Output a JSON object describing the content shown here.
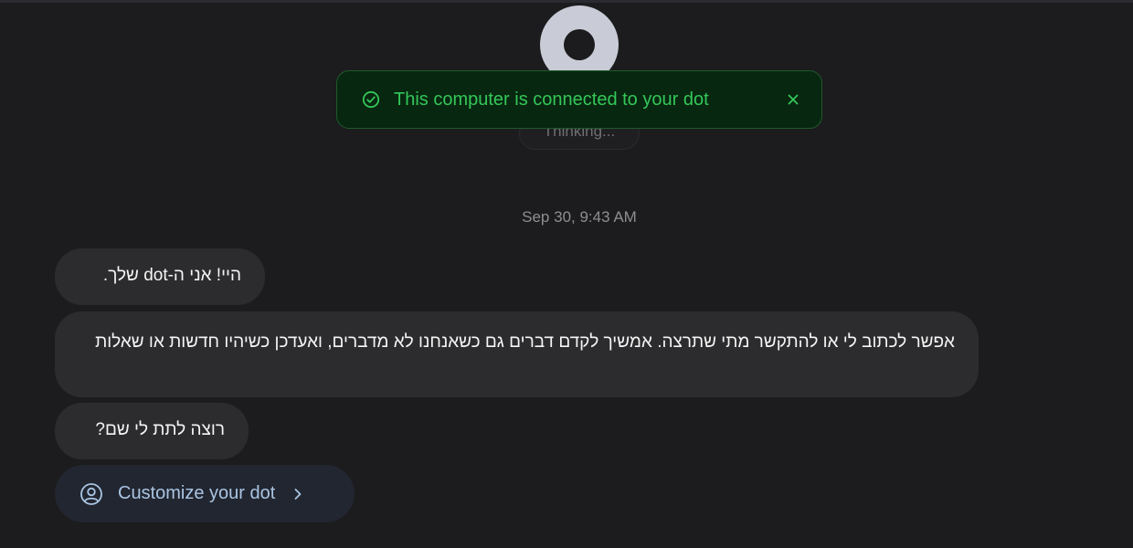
{
  "header": {
    "avatar_icon": "dot-avatar-icon",
    "thinking_label": "Thinking..."
  },
  "toast": {
    "message": "This computer is connected to your dot",
    "status_icon": "check-circle-icon",
    "close_icon": "close-icon",
    "accent_color": "#34c759"
  },
  "chat": {
    "timestamp": "Sep 30, 9:43 AM",
    "messages": [
      {
        "text": "היי! אני ה-dot שלך."
      },
      {
        "text": "אפשר לכתוב לי או להתקשר מתי שתרצה. אמשיך לקדם דברים גם כשאנחנו לא מדברים, ואעדכן כשיהיו חדשות או שאלות"
      },
      {
        "text": "רוצה לתת לי שם?"
      }
    ],
    "action": {
      "label": "Customize your dot",
      "icon": "user-circle-icon",
      "trailing_icon": "chevron-right-icon"
    }
  }
}
